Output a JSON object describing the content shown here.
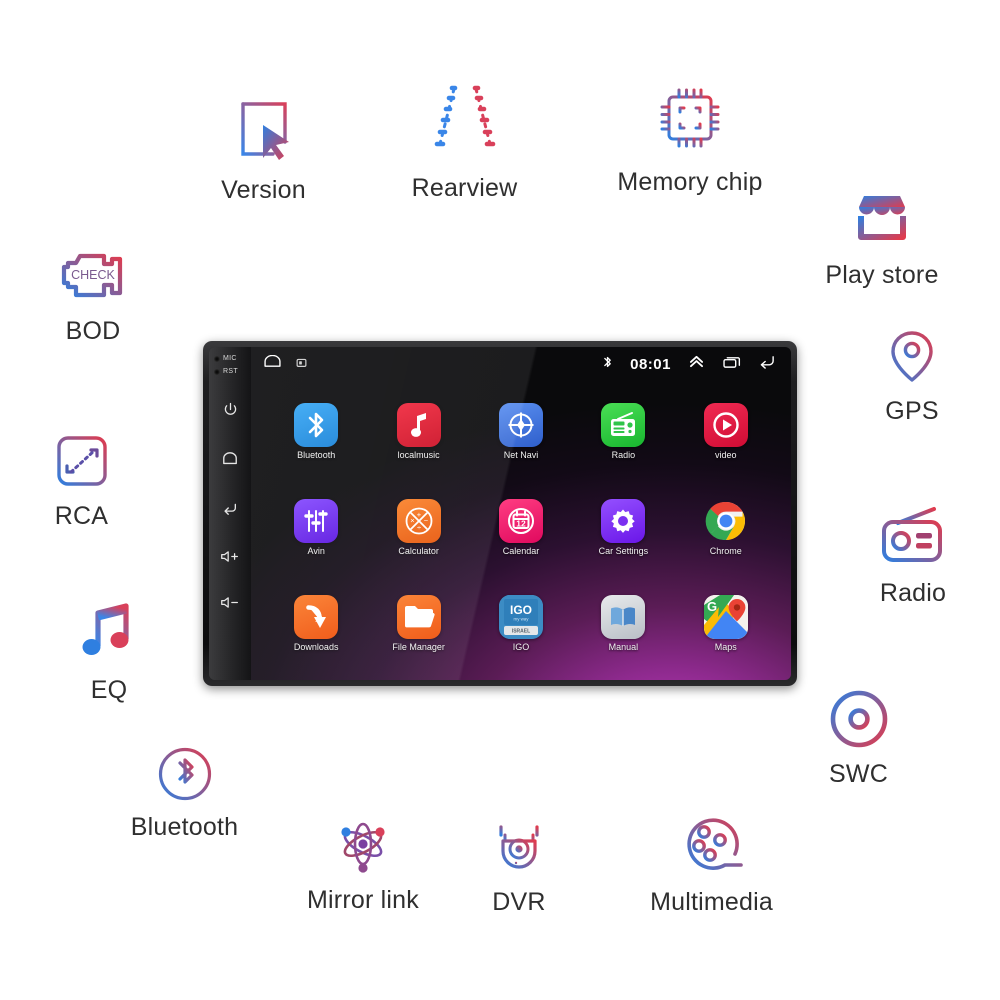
{
  "device": {
    "name": "android-car-head-unit",
    "bezel": {
      "mic_label": "MIC",
      "rst_label": "RST",
      "buttons": [
        {
          "name": "power-button",
          "icon": "power-icon"
        },
        {
          "name": "home-button",
          "icon": "home-icon"
        },
        {
          "name": "back-button",
          "icon": "back-icon"
        },
        {
          "name": "volume-up-button",
          "icon": "volume-up-icon"
        },
        {
          "name": "volume-down-button",
          "icon": "volume-down-icon"
        }
      ]
    },
    "statusbar": {
      "home_icon": "home-outline-icon",
      "screenshot_icon": "screenshot-icon",
      "bluetooth_icon": "bluetooth-icon",
      "clock": "08:01",
      "expand_icon": "double-chevron-up-icon",
      "recents_icon": "recents-icon",
      "back_icon": "back-arrow-icon"
    },
    "apps": [
      {
        "label": "Bluetooth",
        "icon": "bluetooth-app-icon",
        "color": "#2196f3"
      },
      {
        "label": "localmusic",
        "icon": "music-note-app-icon",
        "color": "#e8192c"
      },
      {
        "label": "Net Navi",
        "icon": "compass-app-icon",
        "color": "#3f74e0"
      },
      {
        "label": "Radio",
        "icon": "radio-app-icon",
        "color": "#2fc44a"
      },
      {
        "label": "video",
        "icon": "play-circle-app-icon",
        "color": "#e81e46"
      },
      {
        "label": "Avin",
        "icon": "sliders-app-icon",
        "color": "#6d28f0"
      },
      {
        "label": "Calculator",
        "icon": "calculator-app-icon",
        "color": "#f2690d"
      },
      {
        "label": "Calendar",
        "icon": "calendar-app-icon",
        "color": "#f0246e"
      },
      {
        "label": "Car Settings",
        "icon": "gear-app-icon",
        "color": "#7b2ff0"
      },
      {
        "label": "Chrome",
        "icon": "chrome-app-icon",
        "color": "#ffffff"
      },
      {
        "label": "Downloads",
        "icon": "download-arrow-app-icon",
        "color": "#f2660d"
      },
      {
        "label": "File Manager",
        "icon": "folder-app-icon",
        "color": "#f2660d"
      },
      {
        "label": "IGO",
        "icon": "igo-app-icon",
        "color": "#2f86c4"
      },
      {
        "label": "Manual",
        "icon": "book-app-icon",
        "color": "#c9ccd1"
      },
      {
        "label": "Maps",
        "icon": "google-maps-app-icon",
        "color": "#ffffff"
      }
    ],
    "calendar_day": "12",
    "igo_title": "IGO",
    "igo_sub": "my way",
    "igo_tag": "ISRAEL",
    "maps_letter": "G"
  },
  "features": [
    {
      "label": "Version",
      "icon": "version-cursor-icon"
    },
    {
      "label": "Rearview",
      "icon": "rearview-guidelines-icon"
    },
    {
      "label": "Memory chip",
      "icon": "memory-chip-icon"
    },
    {
      "label": "Play store",
      "icon": "play-store-shop-icon"
    },
    {
      "label": "GPS",
      "icon": "gps-pin-icon"
    },
    {
      "label": "Radio",
      "icon": "radio-outline-icon"
    },
    {
      "label": "SWC",
      "icon": "steering-wheel-icon"
    },
    {
      "label": "Multimedia",
      "icon": "film-reel-icon"
    },
    {
      "label": "DVR",
      "icon": "dome-camera-icon"
    },
    {
      "label": "Mirror link",
      "icon": "atom-icon"
    },
    {
      "label": "Bluetooth",
      "icon": "bluetooth-circle-icon"
    },
    {
      "label": "EQ",
      "icon": "music-note-icon"
    },
    {
      "label": "RCA",
      "icon": "rca-resize-icon"
    },
    {
      "label": "BOD",
      "icon": "check-engine-icon"
    }
  ],
  "check_engine_text": "CHECK",
  "colors": {
    "gradient_start": "#2f7fe0",
    "gradient_end": "#e03b4e",
    "label_text": "#2f2f2f",
    "screen_accent": "#b23ab2"
  }
}
